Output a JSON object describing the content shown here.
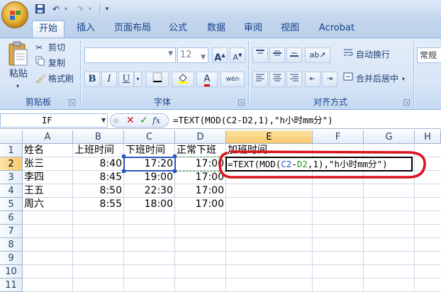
{
  "tabs": [
    "开始",
    "插入",
    "页面布局",
    "公式",
    "数据",
    "审阅",
    "视图",
    "Acrobat"
  ],
  "clipboard": {
    "paste": "粘贴",
    "cut": "剪切",
    "copy": "复制",
    "format_painter": "格式刷",
    "group_label": "剪贴板"
  },
  "font": {
    "size": "12",
    "bold": "B",
    "italic": "I",
    "underline": "U",
    "grow": "A",
    "shrink": "A",
    "font_color": "A",
    "phonetic": "wén",
    "group_label": "字体"
  },
  "alignment": {
    "wrap_text": "自动换行",
    "merge_center": "合并后居中",
    "group_label": "对齐方式"
  },
  "number": {
    "format": "常规"
  },
  "formula_bar": {
    "name_box": "IF",
    "fx": "fx",
    "formula": "=TEXT(MOD(C2-D2,1),\"h小时mm分\")"
  },
  "columns": [
    "A",
    "B",
    "C",
    "D",
    "E",
    "F",
    "G",
    "H"
  ],
  "rows": [
    "1",
    "2",
    "3",
    "4",
    "5",
    "6",
    "7",
    "8",
    "9",
    "10",
    "11"
  ],
  "sheet": {
    "headers": [
      "姓名",
      "上班时间",
      "下班时间",
      "正常下班",
      "加班时间"
    ],
    "data": [
      [
        "张三",
        "8:40",
        "17:20",
        "17:00"
      ],
      [
        "李四",
        "8:45",
        "19:00",
        "17:00"
      ],
      [
        "王五",
        "8:50",
        "22:30",
        "17:00"
      ],
      [
        "周六",
        "8:55",
        "18:00",
        "17:00"
      ]
    ],
    "editing_cell": {
      "prefix": "=TEXT(MOD(",
      "ref1": "C2",
      "op": "-",
      "ref2": "D2",
      "suffix": ",1),\"h小时mm分\")"
    }
  },
  "colors": {
    "ref_c2": "#2a55c0",
    "ref_d2": "#2e8b2e",
    "annotation": "#d8141c",
    "selected_header": "#f9c86a"
  }
}
